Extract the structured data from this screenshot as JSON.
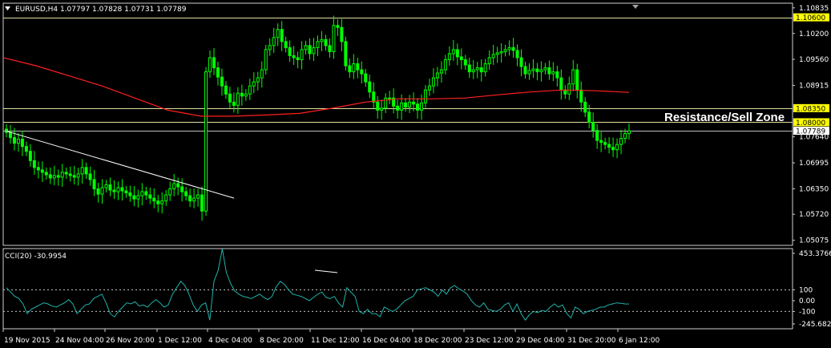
{
  "symbol_line": "EURUSD,H4  1.07797 1.07828 1.07731 1.07789",
  "cci_line": "CCI(20) -30.9954",
  "annotation": "Resistance/Sell Zone",
  "colors": {
    "background": "#000000",
    "candle": "#00ff00",
    "ma": "#ff2020",
    "trendline": "#ffffff",
    "cci": "#20b2aa",
    "level_bg": "#ffff00",
    "last_price_bg": "#ffffff"
  },
  "chart_data": {
    "type": "candlestick",
    "symbol": "EURUSD",
    "timeframe": "H4",
    "ohlc_last": {
      "open": 1.07797,
      "high": 1.07828,
      "low": 1.07731,
      "close": 1.07789
    },
    "price_axis_ticks": [
      "1.10835",
      "1.10200",
      "1.09560",
      "1.08915",
      "1.07640",
      "1.06995",
      "1.06350",
      "1.05720",
      "1.05075"
    ],
    "horizontal_levels": [
      {
        "label": "1.10600",
        "value": 1.106,
        "style": "yellow"
      },
      {
        "label": "1.08350",
        "value": 1.0835,
        "style": "yellow"
      },
      {
        "label": "1.08000",
        "value": 1.08,
        "style": "yellow"
      },
      {
        "label": "1.07789",
        "value": 1.07789,
        "style": "current"
      }
    ],
    "ylim": [
      1.0495,
      1.1095
    ],
    "x_ticks": [
      "19 Nov 2015",
      "24 Nov 04:00",
      "26 Nov 20:00",
      "1 Dec 12:00",
      "4 Dec 04:00",
      "8 Dec 20:00",
      "11 Dec 12:00",
      "16 Dec 04:00",
      "18 Dec 20:00",
      "23 Dec 12:00",
      "29 Dec 04:00",
      "31 Dec 20:00",
      "6 Jan 12:00"
    ],
    "closes": [
      1.0775,
      1.0762,
      1.0748,
      1.0758,
      1.074,
      1.0728,
      1.0705,
      1.0688,
      1.0682,
      1.0676,
      1.067,
      1.0662,
      1.0668,
      1.0664,
      1.0676,
      1.0672,
      1.0668,
      1.0664,
      1.0672,
      1.0688,
      1.0672,
      1.0658,
      1.0635,
      1.0622,
      1.0638,
      1.0645,
      1.0632,
      1.0628,
      1.0638,
      1.063,
      1.0625,
      1.0618,
      1.061,
      1.0618,
      1.0628,
      1.062,
      1.0612,
      1.0605,
      1.0598,
      1.0605,
      1.062,
      1.0635,
      1.0648,
      1.064,
      1.0628,
      1.0618,
      1.0605,
      1.0612,
      1.062,
      1.058,
      1.0925,
      1.096,
      1.0935,
      1.0912,
      1.089,
      1.087,
      1.085,
      1.0842,
      1.0872,
      1.0865,
      1.087,
      1.089,
      1.09,
      1.091,
      1.093,
      1.098,
      1.099,
      1.101,
      1.103,
      1.1,
      1.0985,
      1.0965,
      1.096,
      1.0955,
      1.098,
      1.099,
      1.097,
      1.0985,
      1.1,
      1.1005,
      1.099,
      1.0975,
      1.104,
      1.1035,
      1.1,
      1.094,
      1.0925,
      1.0945,
      1.093,
      1.092,
      1.09,
      1.0875,
      1.085,
      1.083,
      1.0835,
      1.086,
      1.086,
      1.084,
      1.083,
      1.0848,
      1.0838,
      1.085,
      1.0845,
      1.083,
      1.0848,
      1.088,
      1.089,
      1.091,
      1.0922,
      1.093,
      1.0955,
      1.097,
      1.098,
      1.0962,
      1.0955,
      1.0942,
      1.0925,
      1.093,
      1.0935,
      1.0925,
      1.0945,
      1.096,
      1.0968,
      1.0972,
      1.0975,
      1.098,
      1.0985,
      1.0978,
      1.096,
      1.0938,
      1.092,
      1.0928,
      1.0932,
      1.0925,
      1.093,
      1.0935,
      1.092,
      1.0925,
      1.091,
      1.088,
      1.087,
      1.0895,
      1.093,
      1.088,
      1.085,
      1.0825,
      1.08,
      1.078,
      1.0755,
      1.075,
      1.0745,
      1.0738,
      1.0732,
      1.0745,
      1.076,
      1.0772,
      1.0779
    ],
    "ma_curve": [
      1.096,
      1.094,
      1.0915,
      1.089,
      1.086,
      1.083,
      1.0815,
      1.0815,
      1.0818,
      1.0822,
      1.0835,
      1.085,
      1.0858,
      1.0858,
      1.086,
      1.0868,
      1.0875,
      1.088,
      1.0878,
      1.0874
    ],
    "cci_axis_ticks": [
      "453.3766",
      "100",
      "0.00",
      "-100",
      "-245.6828"
    ],
    "cci_ylim": [
      -245.6828,
      453.3766
    ],
    "cci_values": [
      120,
      80,
      40,
      20,
      -30,
      -120,
      -80,
      -60,
      -40,
      -20,
      -30,
      -50,
      -60,
      -40,
      -20,
      10,
      -30,
      -120,
      -80,
      -40,
      -30,
      20,
      40,
      60,
      -20,
      -120,
      -150,
      -100,
      -60,
      -20,
      -30,
      -10,
      -50,
      -40,
      -60,
      -20,
      10,
      -20,
      -60,
      -40,
      60,
      120,
      180,
      140,
      60,
      -40,
      -100,
      -40,
      -20,
      -180,
      180,
      280,
      480,
      260,
      160,
      90,
      60,
      40,
      30,
      20,
      40,
      60,
      30,
      10,
      40,
      130,
      180,
      150,
      100,
      60,
      50,
      40,
      20,
      0,
      30,
      60,
      80,
      30,
      20,
      40,
      -20,
      -60,
      120,
      80,
      40,
      -100,
      -120,
      -80,
      -120,
      -120,
      -150,
      -60,
      -80,
      -100,
      -80,
      -40,
      0,
      20,
      40,
      100,
      110,
      120,
      100,
      80,
      40,
      100,
      60,
      120,
      140,
      110,
      90,
      60,
      0,
      -40,
      -60,
      -20,
      -80,
      -90,
      -100,
      -80,
      -40,
      -20,
      -100,
      -30,
      -120,
      -180,
      -130,
      -100,
      -110,
      -90,
      -100,
      -60,
      -30,
      -60,
      -40,
      -120,
      -160,
      -60,
      -80,
      -120,
      -100,
      -90,
      -80,
      -60,
      -60,
      -40,
      -30,
      -20,
      -25,
      -30,
      -31
    ]
  }
}
